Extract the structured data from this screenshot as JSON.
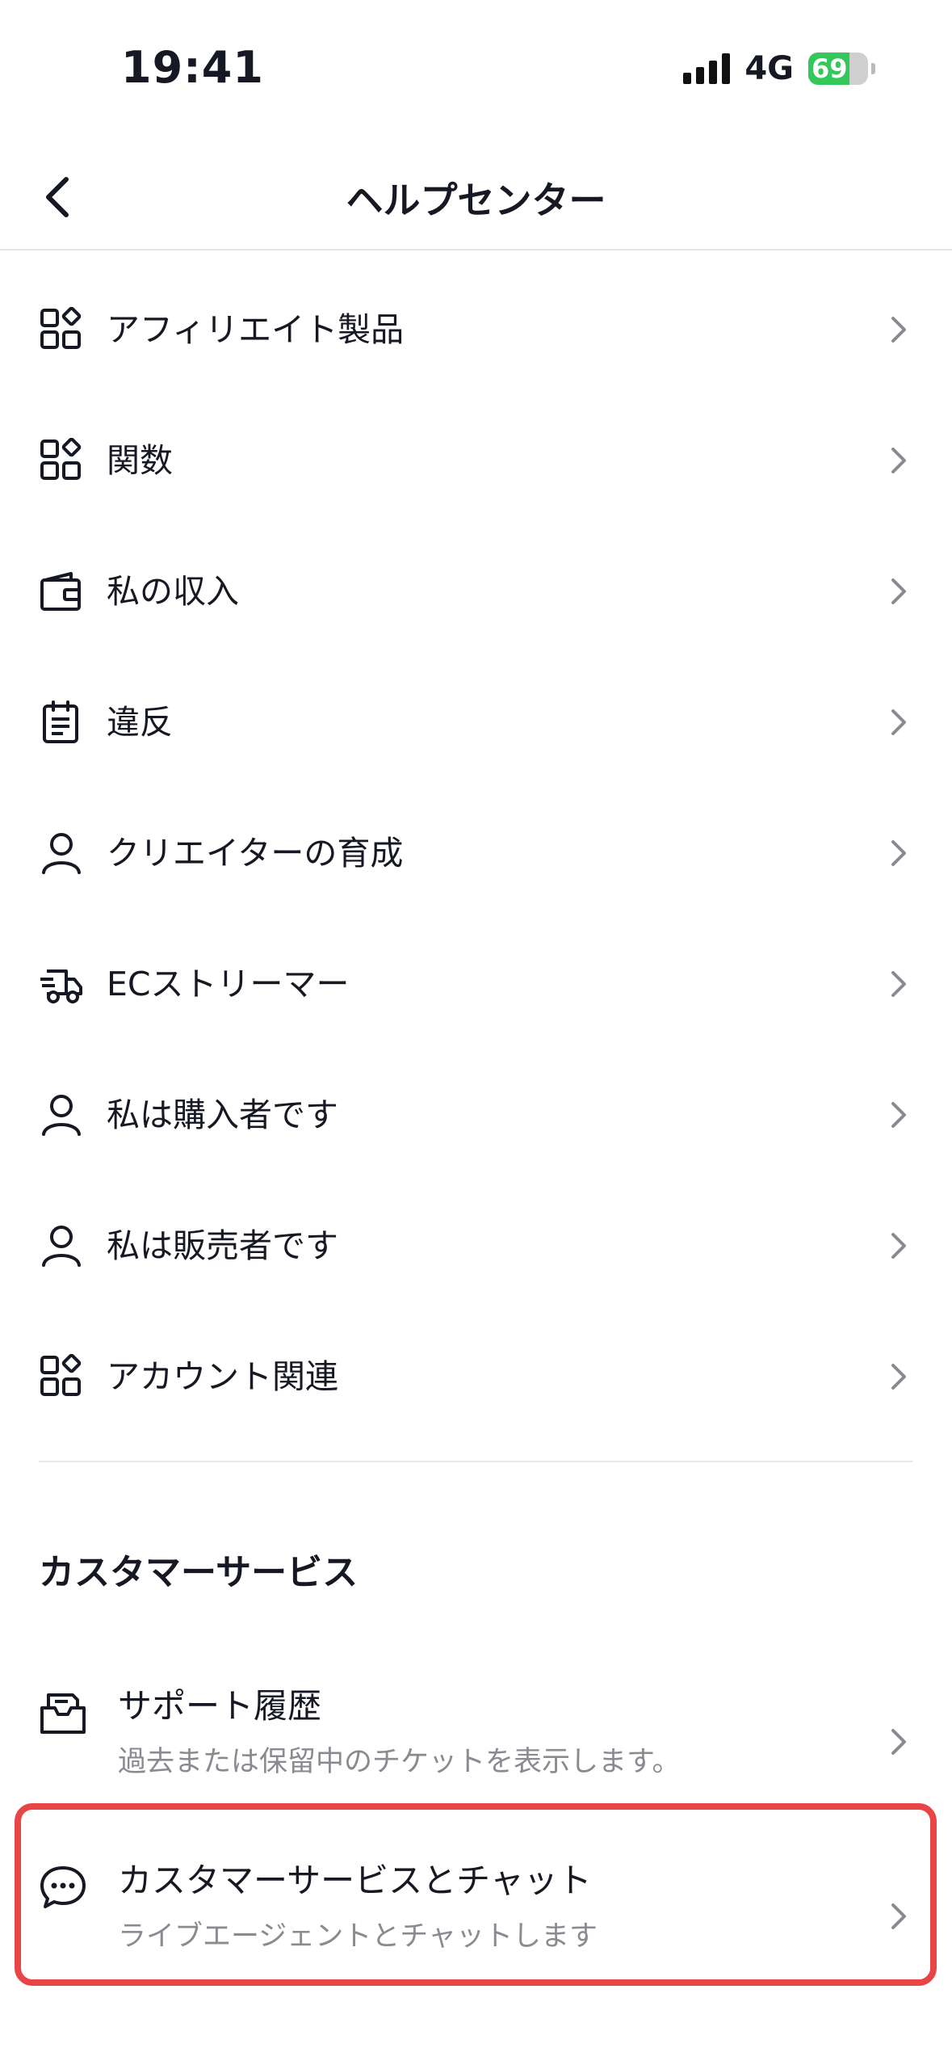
{
  "status_bar": {
    "time": "19:41",
    "network": "4G",
    "battery": "69",
    "battery_level": 0.69
  },
  "header": {
    "title": "ヘルプセンター"
  },
  "menu": [
    {
      "label": "アフィリエイト製品",
      "icon": "apps-icon"
    },
    {
      "label": "関数",
      "icon": "apps-icon"
    },
    {
      "label": "私の収入",
      "icon": "wallet-icon"
    },
    {
      "label": "違反",
      "icon": "clipboard-icon"
    },
    {
      "label": "クリエイターの育成",
      "icon": "person-icon"
    },
    {
      "label": "ECストリーマー",
      "icon": "delivery-truck-icon"
    },
    {
      "label": "私は購入者です",
      "icon": "person-icon"
    },
    {
      "label": "私は販売者です",
      "icon": "person-icon"
    },
    {
      "label": "アカウント関連",
      "icon": "apps-icon"
    }
  ],
  "customer_service": {
    "title": "カスタマーサービス",
    "items": [
      {
        "label": "サポート履歴",
        "sub": "過去または保留中のチケットを表示します。",
        "icon": "inbox-icon"
      },
      {
        "label": "カスタマーサービスとチャット",
        "sub": "ライブエージェントとチャットします",
        "icon": "chat-bubble-icon"
      }
    ]
  },
  "colors": {
    "accent_outline": "#e84646",
    "battery_green": "#34c759",
    "text": "#161823",
    "secondary_text": "#8a8b91"
  }
}
